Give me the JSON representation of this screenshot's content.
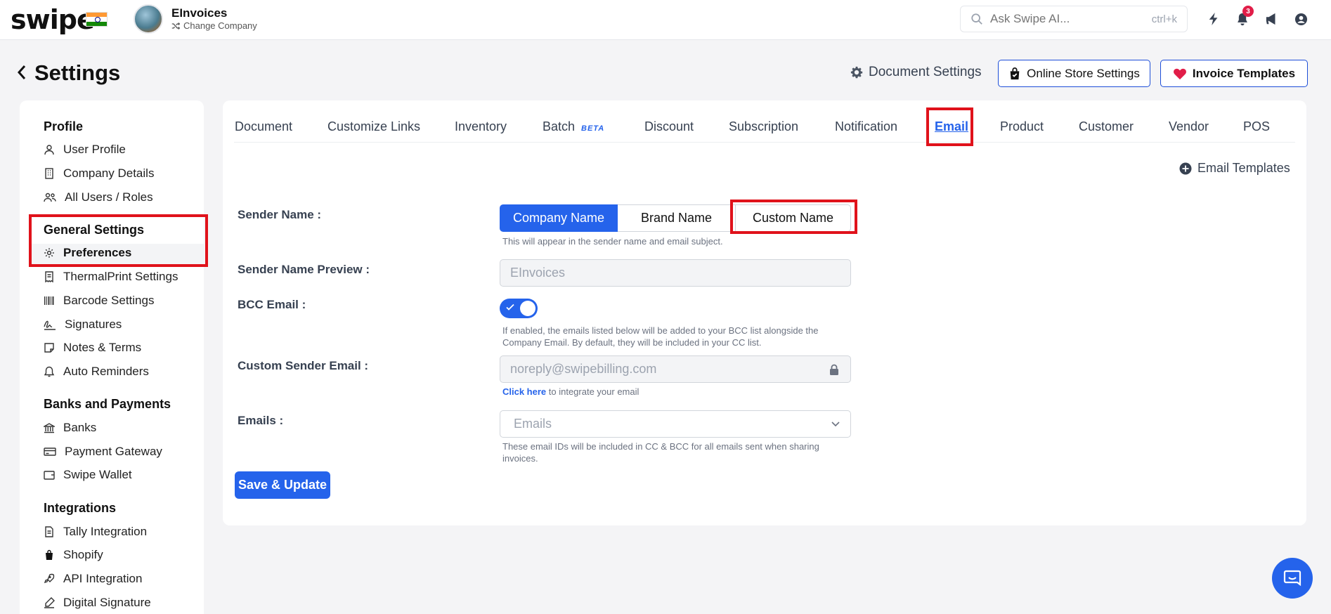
{
  "topbar": {
    "logo": "swipe",
    "company_name": "EInvoices",
    "change_company": "Change Company",
    "search_placeholder": "Ask Swipe AI...",
    "search_shortcut": "ctrl+k",
    "notification_count": "3"
  },
  "header": {
    "title": "Settings",
    "document_settings": "Document Settings",
    "online_store_settings": "Online Store Settings",
    "invoice_templates": "Invoice Templates"
  },
  "sidebar": {
    "profile": {
      "title": "Profile",
      "items": [
        "User Profile",
        "Company Details",
        "All Users / Roles"
      ]
    },
    "general": {
      "title": "General Settings",
      "items": [
        "Preferences",
        "ThermalPrint Settings",
        "Barcode Settings",
        "Signatures",
        "Notes & Terms",
        "Auto Reminders"
      ]
    },
    "banks": {
      "title": "Banks and Payments",
      "items": [
        "Banks",
        "Payment Gateway",
        "Swipe Wallet"
      ]
    },
    "integrations": {
      "title": "Integrations",
      "items": [
        "Tally Integration",
        "Shopify",
        "API Integration",
        "Digital Signature"
      ]
    }
  },
  "tabs": [
    "Document",
    "Customize Links",
    "Inventory",
    "Batch",
    "Discount",
    "Subscription",
    "Notification",
    "Email",
    "Product",
    "Customer",
    "Vendor",
    "POS"
  ],
  "beta_label": "BETA",
  "active_tab": "Email",
  "email_templates": "Email Templates",
  "form": {
    "sender_name_label": "Sender Name :",
    "sender_options": [
      "Company Name",
      "Brand Name",
      "Custom Name"
    ],
    "sender_selected": "Company Name",
    "sender_hint": "This will appear in the sender name and email subject.",
    "preview_label": "Sender Name Preview :",
    "preview_value": "EInvoices",
    "bcc_label": "BCC Email :",
    "bcc_enabled": true,
    "bcc_hint_1": "If enabled, the emails listed below will be added to your BCC list alongside the",
    "bcc_hint_2": "Company Email. By default, they will be included in your CC list.",
    "custom_email_label": "Custom Sender Email :",
    "custom_email_value": "noreply@swipebilling.com",
    "click_here": "Click here",
    "integrate_text": " to integrate your email",
    "emails_label": "Emails :",
    "emails_placeholder": "Emails",
    "emails_hint_1": "These email IDs will be included in CC & BCC for all emails sent when sharing",
    "emails_hint_2": "invoices.",
    "save_button": "Save & Update"
  },
  "colors": {
    "primary": "#2563eb",
    "highlight": "#e0121b",
    "heart": "#e11d48"
  }
}
